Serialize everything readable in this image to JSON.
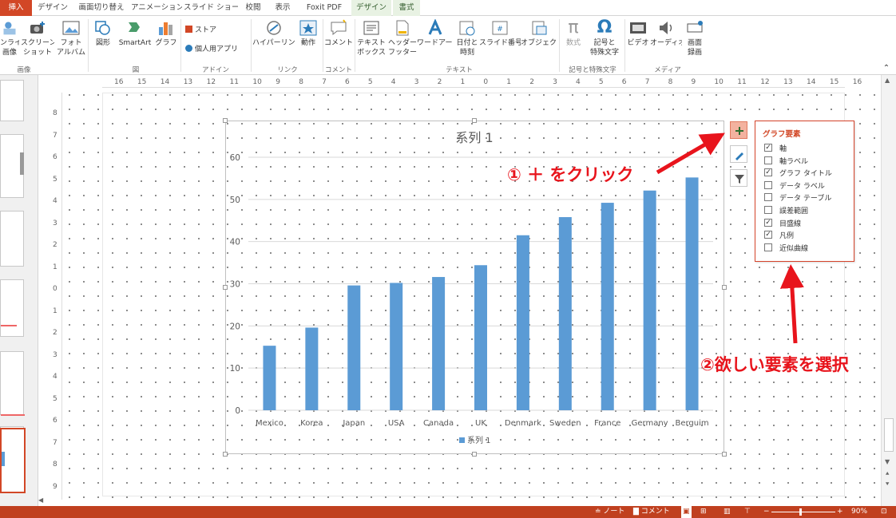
{
  "tabs": {
    "items": [
      {
        "label": "挿入",
        "state": "active"
      },
      {
        "label": "デザイン",
        "state": ""
      },
      {
        "label": "画面切り替え",
        "state": ""
      },
      {
        "label": "アニメーション",
        "state": ""
      },
      {
        "label": "スライド ショー",
        "state": ""
      },
      {
        "label": "校閲",
        "state": ""
      },
      {
        "label": "表示",
        "state": ""
      },
      {
        "label": "Foxit PDF",
        "state": ""
      },
      {
        "label": "デザイン",
        "state": "ctx"
      },
      {
        "label": "書式",
        "state": "ctx"
      }
    ]
  },
  "ribbon": {
    "online_image": "ンライン\n画像",
    "screenshot": "スクリーン\nショット",
    "photo_album": "フォト\nアルバム",
    "shapes": "図形",
    "smartart": "SmartArt",
    "graph": "グラフ",
    "store": "ストア",
    "my_apps": "個人用アプリ",
    "hyperlink": "ハイパーリンク",
    "action": "動作",
    "comment": "コメント",
    "textbox": "テキスト\nボックス",
    "header_footer": "ヘッダーと\nフッター",
    "wordart": "ワードアート",
    "datetime": "日付と\n時刻",
    "slide_number": "スライド番号",
    "object": "オブジェクト",
    "equation": "数式",
    "symbol": "記号と\n特殊文字",
    "video": "ビデオ",
    "audio": "オーディオ",
    "screen_recording": "画面\n録画",
    "groups": {
      "images": "画像",
      "illustrations": "図",
      "addins": "アドイン",
      "links": "リンク",
      "comments": "コメント",
      "text": "テキスト",
      "symbols": "記号と特殊文字",
      "media": "メディア"
    }
  },
  "rulers": {
    "h_ticks": [
      "16",
      "15",
      "14",
      "13",
      "12",
      "11",
      "10",
      "9",
      "8",
      "7",
      "6",
      "5",
      "4",
      "3",
      "2",
      "1",
      "0",
      "1",
      "2",
      "3",
      "4",
      "5",
      "6",
      "7",
      "8",
      "9",
      "10",
      "11",
      "12",
      "13",
      "14",
      "15",
      "16"
    ],
    "v_ticks": [
      "8",
      "7",
      "6",
      "5",
      "4",
      "3",
      "2",
      "1",
      "0",
      "1",
      "2",
      "3",
      "4",
      "5",
      "6",
      "7",
      "8",
      "9"
    ]
  },
  "colors": {
    "accent": "#d24726",
    "bar": "#5b9bd5",
    "annotation": "#e8141c"
  },
  "chart_data": {
    "type": "bar",
    "title": "系列 1",
    "categories": [
      "Mexico",
      "Korea",
      "Japan",
      "USA",
      "Canada",
      "UK",
      "Denmark",
      "Sweden",
      "France",
      "Germany",
      "Berguim"
    ],
    "series": [
      {
        "name": "系列 1",
        "values": [
          15.3,
          19.6,
          29.6,
          30.2,
          31.6,
          34.4,
          41.5,
          45.8,
          49.2,
          52.1,
          55.2
        ]
      }
    ],
    "yticks": [
      "0",
      "10",
      "20",
      "30",
      "40",
      "50",
      "60"
    ],
    "ylim": [
      0,
      60
    ],
    "xlabel": "",
    "ylabel": "",
    "grid": true,
    "legend": "bottom"
  },
  "popup": {
    "title": "グラフ要素",
    "items": [
      {
        "label": "軸",
        "checked": true
      },
      {
        "label": "軸ラベル",
        "checked": false
      },
      {
        "label": "グラフ タイトル",
        "checked": true
      },
      {
        "label": "データ ラベル",
        "checked": false
      },
      {
        "label": "データ テーブル",
        "checked": false
      },
      {
        "label": "誤差範囲",
        "checked": false
      },
      {
        "label": "目盛線",
        "checked": true
      },
      {
        "label": "凡例",
        "checked": true
      },
      {
        "label": "近似曲線",
        "checked": false
      }
    ]
  },
  "annotations": {
    "step1": "① ＋ をクリック",
    "step2": "②欲しい要素を選択"
  },
  "status": {
    "notes": "ノート",
    "comments": "コメント",
    "zoom": "90%"
  }
}
